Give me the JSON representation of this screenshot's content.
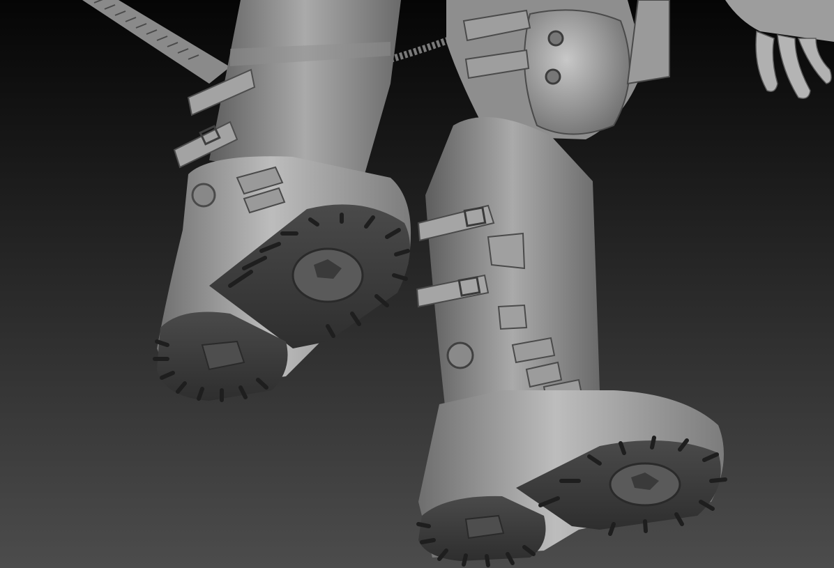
{
  "scene": {
    "subject": "sculpt-render",
    "background_top": "#050505",
    "background_bottom": "#4c4c4c",
    "material_light": "#c4c4c4",
    "material_mid": "#8e8e8e",
    "material_dark": "#3a3a3a"
  }
}
